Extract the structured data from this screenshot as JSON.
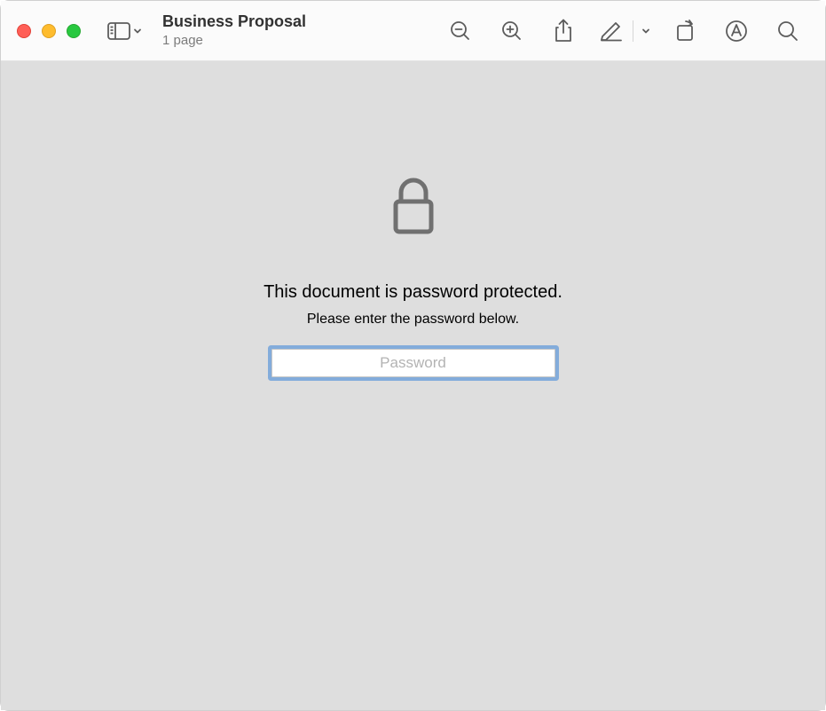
{
  "header": {
    "title": "Business Proposal",
    "subtitle": "1 page"
  },
  "lock": {
    "primary": "This document is password protected.",
    "secondary": "Please enter the password below.",
    "placeholder": "Password"
  }
}
